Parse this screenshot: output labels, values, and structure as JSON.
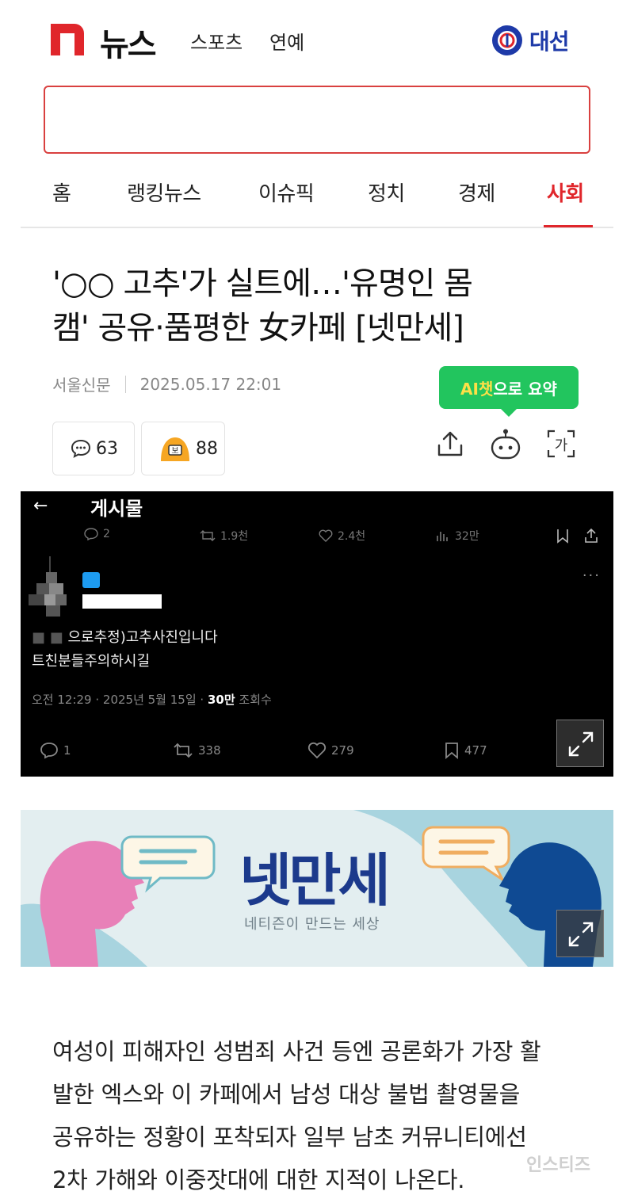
{
  "header": {
    "logo_text": "뉴스",
    "nav": [
      "스포츠",
      "연예"
    ],
    "election_label": "대선",
    "brand_color": "#e0262b"
  },
  "search": {
    "value": "",
    "placeholder": ""
  },
  "tabs": [
    {
      "label": "홈",
      "active": false
    },
    {
      "label": "랭킹뉴스",
      "active": false
    },
    {
      "label": "이슈픽",
      "active": false
    },
    {
      "label": "정치",
      "active": false
    },
    {
      "label": "경제",
      "active": false
    },
    {
      "label": "사회",
      "active": true
    }
  ],
  "article": {
    "headline_line1": "'○○ 고추'가 실트에…'유명인 몸",
    "headline_line2": "캠' 공유·품평한 女카페 [넷만세]",
    "publisher": "서울신문",
    "datetime": "2025.05.17 22:01",
    "ai_summary_prefix": "AI챗",
    "ai_summary_suffix": "으로 요약",
    "comments_count": "63",
    "reactions_count": "88",
    "font_button_label": "가",
    "body_lines": [
      "여성이 피해자인 성범죄 사건 등엔 공론화가 가장 활",
      "발한 엑스와 이 카페에서 남성 대상 불법 촬영물을",
      "공유하는 정황이 포착되자 일부 남초 커뮤니티에선",
      "2차 가해와 이중잣대에 대한 지적이 나온다."
    ]
  },
  "tweet_image": {
    "back_arrow": "←",
    "title": "게시물",
    "top_stats": {
      "replies": "2",
      "retweets": "1.9천",
      "likes": "2.4천",
      "views": "32만"
    },
    "more": "···",
    "line1_prefix": "■ ■",
    "line1": "으로추정)고추사진입니다",
    "line2": "트친분들주의하시길",
    "meta_time": "오전 12:29 · 2025년 5월 15일 · ",
    "meta_views": "30만",
    "meta_views_label": " 조회수",
    "bottom_stats": {
      "replies": "1",
      "retweets": "338",
      "likes": "279",
      "bookmarks": "477"
    }
  },
  "banner": {
    "title": "넷만세",
    "subtitle": "네티즌이 만드는 세상"
  },
  "watermark": "인스티즈"
}
